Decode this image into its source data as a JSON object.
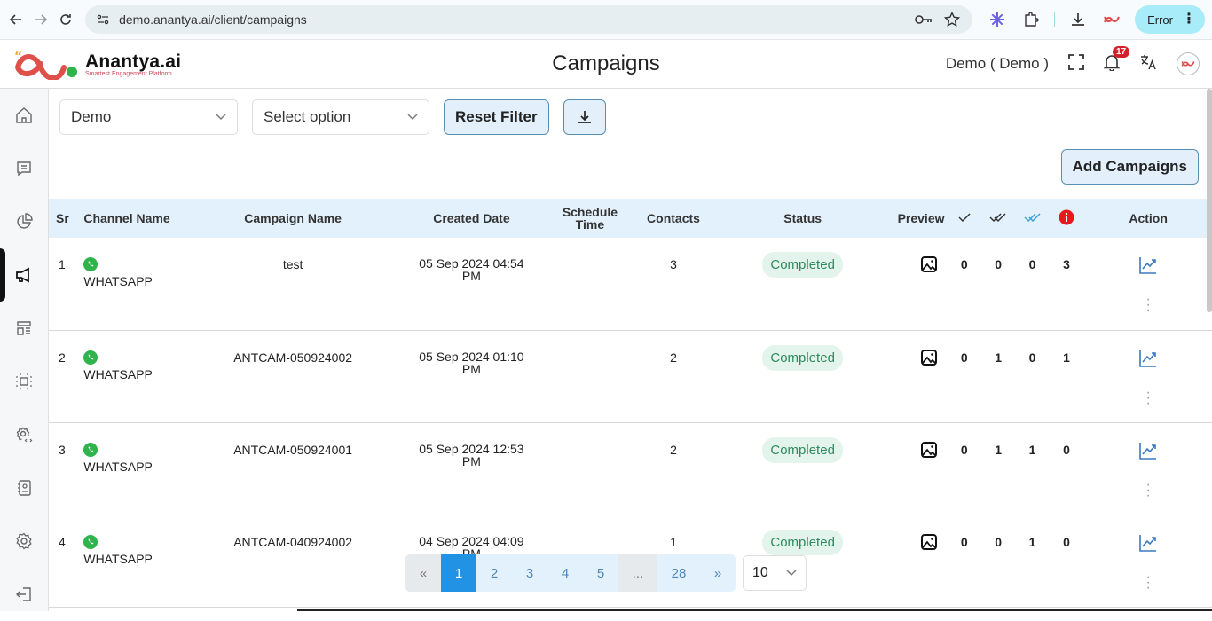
{
  "browser": {
    "url": "demo.anantya.ai/client/campaigns",
    "error_label": "Error"
  },
  "app": {
    "brand_name": "Anantya.ai",
    "brand_tagline": "Smartest Engagement Platform",
    "page_title": "Campaigns",
    "user_label": "Demo ( Demo )",
    "notification_count": "17",
    "colors": {
      "accent": "#2292e4",
      "status_green": "#2f8a5e",
      "error_red": "#d3202a"
    }
  },
  "sidebar": {
    "items": [
      {
        "name": "home",
        "icon": "home-icon"
      },
      {
        "name": "chat",
        "icon": "chat-icon"
      },
      {
        "name": "analytics",
        "icon": "pie-chart-icon"
      },
      {
        "name": "campaigns",
        "icon": "megaphone-icon",
        "active": true
      },
      {
        "name": "templates",
        "icon": "layout-icon"
      },
      {
        "name": "flows",
        "icon": "focus-icon"
      },
      {
        "name": "developer-settings",
        "icon": "gear-code-icon"
      },
      {
        "name": "contacts",
        "icon": "contact-book-icon"
      },
      {
        "name": "settings",
        "icon": "gear-icon"
      },
      {
        "name": "logout",
        "icon": "logout-icon"
      }
    ]
  },
  "filters": {
    "account_value": "Demo",
    "option_placeholder": "Select option",
    "reset_label": "Reset Filter",
    "add_label": "Add Campaigns"
  },
  "table": {
    "headers": {
      "sr": "Sr",
      "channel": "Channel Name",
      "campaign": "Campaign Name",
      "created": "Created Date",
      "schedule_1": "Schedule",
      "schedule_2": "Time",
      "contacts": "Contacts",
      "status": "Status",
      "preview": "Preview",
      "sent_icon": "single-check-icon",
      "delivered_icon": "double-check-icon",
      "read_icon": "double-check-blue-icon",
      "failed_icon": "error-info-icon",
      "action": "Action"
    },
    "rows": [
      {
        "sr": "1",
        "channel": "WHATSAPP",
        "campaign": "test",
        "date_1": "05 Sep 2024 04:54",
        "date_2": "PM",
        "schedule": "",
        "contacts": "3",
        "status": "Completed",
        "sent": "0",
        "delivered": "0",
        "read": "0",
        "failed": "3"
      },
      {
        "sr": "2",
        "channel": "WHATSAPP",
        "campaign": "ANTCAM-050924002",
        "date_1": "05 Sep 2024 01:10",
        "date_2": "PM",
        "schedule": "",
        "contacts": "2",
        "status": "Completed",
        "sent": "0",
        "delivered": "1",
        "read": "0",
        "failed": "1"
      },
      {
        "sr": "3",
        "channel": "WHATSAPP",
        "campaign": "ANTCAM-050924001",
        "date_1": "05 Sep 2024 12:53",
        "date_2": "PM",
        "schedule": "",
        "contacts": "2",
        "status": "Completed",
        "sent": "0",
        "delivered": "1",
        "read": "1",
        "failed": "0"
      },
      {
        "sr": "4",
        "channel": "WHATSAPP",
        "campaign": "ANTCAM-040924002",
        "date_1": "04 Sep 2024 04:09",
        "date_2": "PM",
        "schedule": "",
        "contacts": "1",
        "status": "Completed",
        "sent": "0",
        "delivered": "0",
        "read": "1",
        "failed": "0"
      }
    ]
  },
  "pagination": {
    "first": "«",
    "pages": [
      "1",
      "2",
      "3",
      "4",
      "5"
    ],
    "ellipsis": "...",
    "last_page": "28",
    "next": "»",
    "current": "1",
    "per_page": "10"
  }
}
